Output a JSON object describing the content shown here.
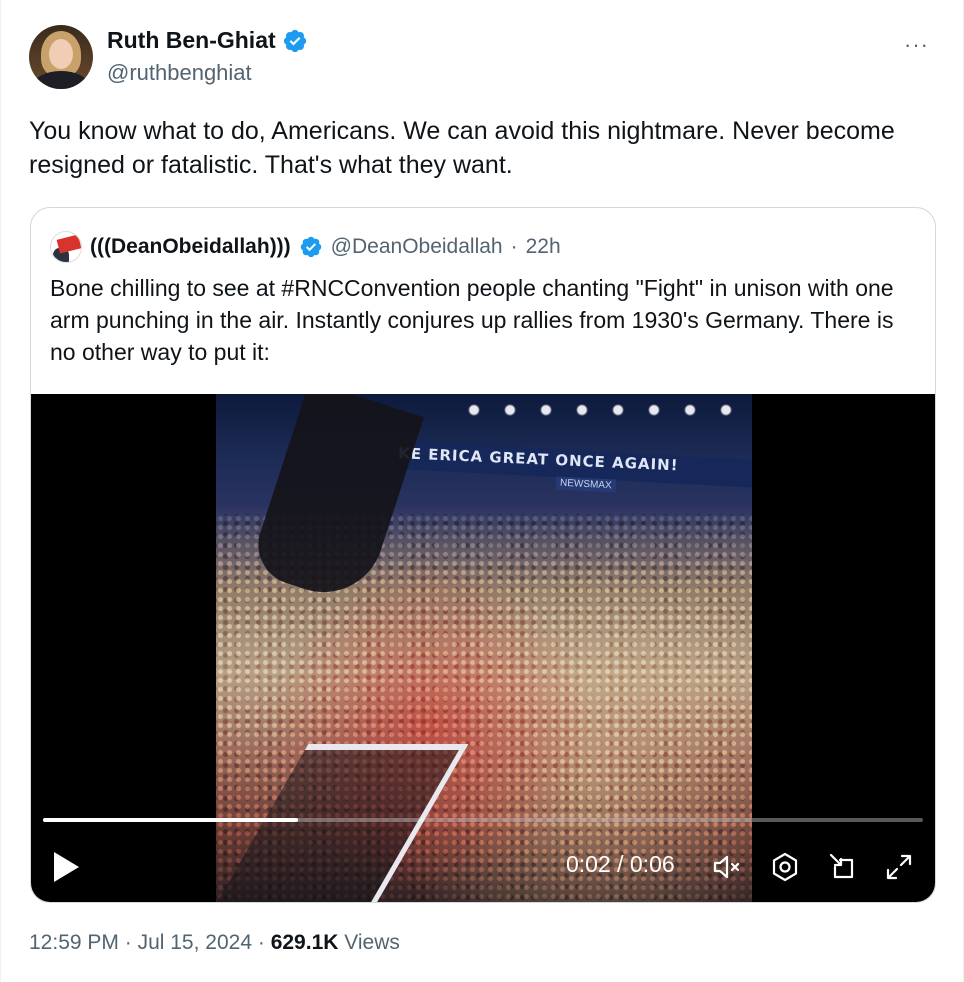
{
  "author": {
    "name": "Ruth Ben-Ghiat",
    "handle": "@ruthbenghiat"
  },
  "more_label": "···",
  "tweet_text": "You know what to do, Americans. We can avoid this nightmare. Never become resigned or fatalistic. That's what they want.",
  "quoted": {
    "name": "(((DeanObeidallah)))",
    "handle": "@DeanObeidallah",
    "separator": "·",
    "time": "22h",
    "text": "Bone chilling to see at #RNCConvention people chanting \"Fight\" in unison with one arm punching in the air. Instantly conjures up rallies from 1930's Germany. There is no other way to put it:",
    "video": {
      "banner_text": "KE  ERICA GREAT ONCE AGAIN!",
      "newsmax_text": "NEWSMAX",
      "time_display": "0:02 / 0:06",
      "progress_fraction": 0.29
    }
  },
  "meta": {
    "time": "12:59 PM",
    "dot1": "·",
    "date": "Jul 15, 2024",
    "dot2": "·",
    "views_count": "629.1K",
    "views_label": "Views"
  },
  "colors": {
    "verified_blue": "#1d9bf0",
    "text_primary": "#0f1419",
    "text_secondary": "#536471",
    "border": "#cfd9de"
  },
  "icons": [
    "verified-badge-icon",
    "more-icon",
    "play-icon",
    "mute-icon",
    "settings-icon",
    "pip-icon",
    "fullscreen-icon"
  ]
}
